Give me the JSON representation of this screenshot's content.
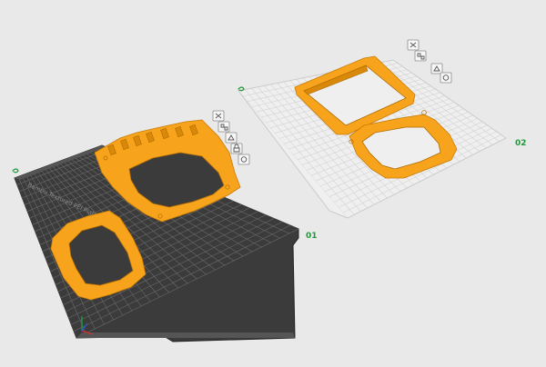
{
  "plates": [
    {
      "label": "01",
      "brand_text": "Bambu Textured PEI Plate",
      "tools": [
        "delete-icon",
        "arrange-icon",
        "orient-icon",
        "lock-icon",
        "settings-icon"
      ]
    },
    {
      "label": "02",
      "tools": [
        "delete-icon",
        "arrange-icon",
        "orient-icon",
        "settings-icon"
      ]
    }
  ],
  "colors": {
    "background": "#e9e9e9",
    "plate_dark": "#3a3a3a",
    "plate_light": "#efefef",
    "filament": "#f7a41c",
    "label_green": "#1f9a3a"
  }
}
